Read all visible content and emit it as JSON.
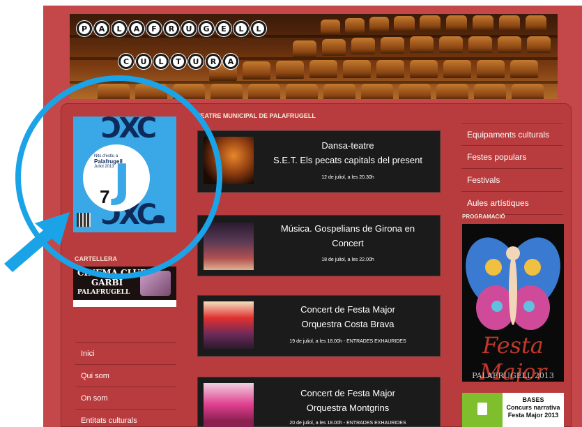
{
  "header": {
    "logo_line1": [
      "P",
      "A",
      "L",
      "A",
      "F",
      "R",
      "U",
      "G",
      "E",
      "L",
      "L"
    ],
    "logo_line2": [
      "C",
      "U",
      "L",
      "T",
      "U",
      "R",
      "A"
    ]
  },
  "left": {
    "promo": {
      "title_line1": "Nits d'estiu a",
      "title_line2": "Palafrugell",
      "title_line3": "Juliol 2013",
      "big_letter": "J",
      "big_number": "7"
    },
    "cartellera_title": "CARTELLERA",
    "cinema": {
      "line1": "CINEMA CLUB",
      "line2": "GARBÍ",
      "line3": "PALAFRUGELL"
    },
    "nav": [
      {
        "label": "Inici"
      },
      {
        "label": "Qui som"
      },
      {
        "label": "On som"
      },
      {
        "label": "Entitats culturals"
      }
    ]
  },
  "center": {
    "section_title": "TEATRE MUNICIPAL DE PALAFRUGELL",
    "events": [
      {
        "title_line1": "Dansa-teatre",
        "title_line2": "S.E.T. Els pecats capitals del present",
        "date": "12 de juliol, a les 20.30h"
      },
      {
        "title_line1": "Música. Gospelians de Girona en",
        "title_line2": "Concert",
        "date": "18 de juliol, a les 22.00h"
      },
      {
        "title_line1": "Concert de Festa Major",
        "title_line2": "Orquestra Costa Brava",
        "date": "19 de juliol, a les 18.00h - ENTRADES EXHAURIDES"
      },
      {
        "title_line1": "Concert de Festa Major",
        "title_line2": "Orquestra Montgrins",
        "date": "20 de juliol, a les 18.00h - ENTRADES EXHAURIDES"
      }
    ]
  },
  "right": {
    "menu": [
      {
        "label": "Equipaments culturals"
      },
      {
        "label": "Festes populars"
      },
      {
        "label": "Festivals"
      },
      {
        "label": "Aules artístiques"
      }
    ],
    "programacio_title": "PROGRAMACIÓ",
    "poster": {
      "title": "Festa Major",
      "footer": "PALAFRUGELL 2013"
    },
    "bases": {
      "line1": "BASES",
      "line2": "Concurs narrativa",
      "line3": "Festa Major 2013"
    }
  },
  "colors": {
    "page_red": "#c4484a",
    "panel_red": "#b83c3e",
    "event_bg": "#1b1b1b",
    "annotation_blue": "#1ba3e8"
  }
}
